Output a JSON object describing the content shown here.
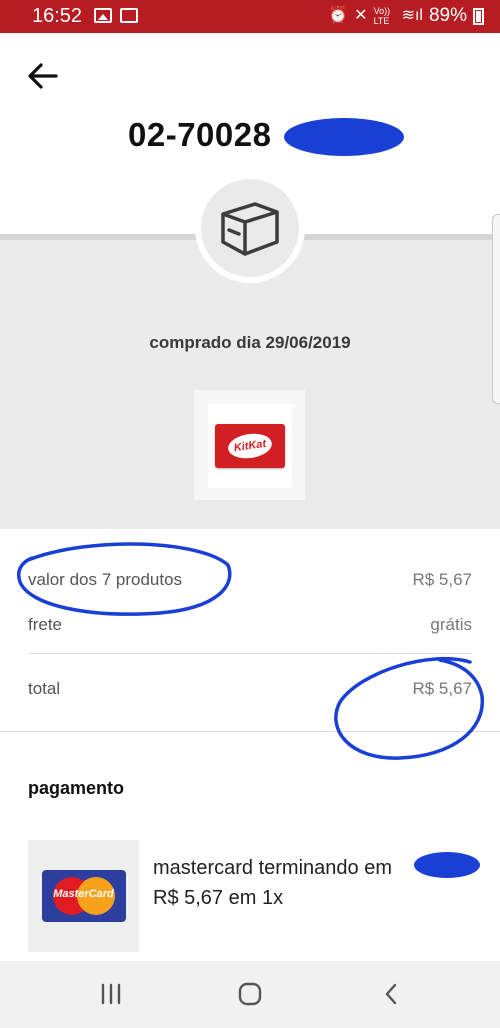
{
  "status_bar": {
    "time": "16:52",
    "volte_label": "Vo)) LTE",
    "battery": "89%"
  },
  "header": {
    "order_number": "02-70028"
  },
  "order": {
    "purchase_date": "comprado dia 29/06/2019",
    "product_image_icon": "kitkat-product-image",
    "product_logo_text": "KitKat"
  },
  "summary": {
    "products_label": "valor dos 7 produtos",
    "products_value": "R$ 5,67",
    "shipping_label": "frete",
    "shipping_value": "grátis",
    "total_label": "total",
    "total_value": "R$ 5,67"
  },
  "payment": {
    "heading": "pagamento",
    "card_logo_text": "MasterCard",
    "card_description": "mastercard terminando em",
    "installments": "R$ 5,67 em 1x"
  },
  "colors": {
    "status_bar": "#b71c23",
    "annotation_blue": "#1a3fd6"
  },
  "icons": [
    "back-arrow-icon",
    "box-icon",
    "recent-apps-icon",
    "home-icon",
    "nav-back-icon"
  ]
}
